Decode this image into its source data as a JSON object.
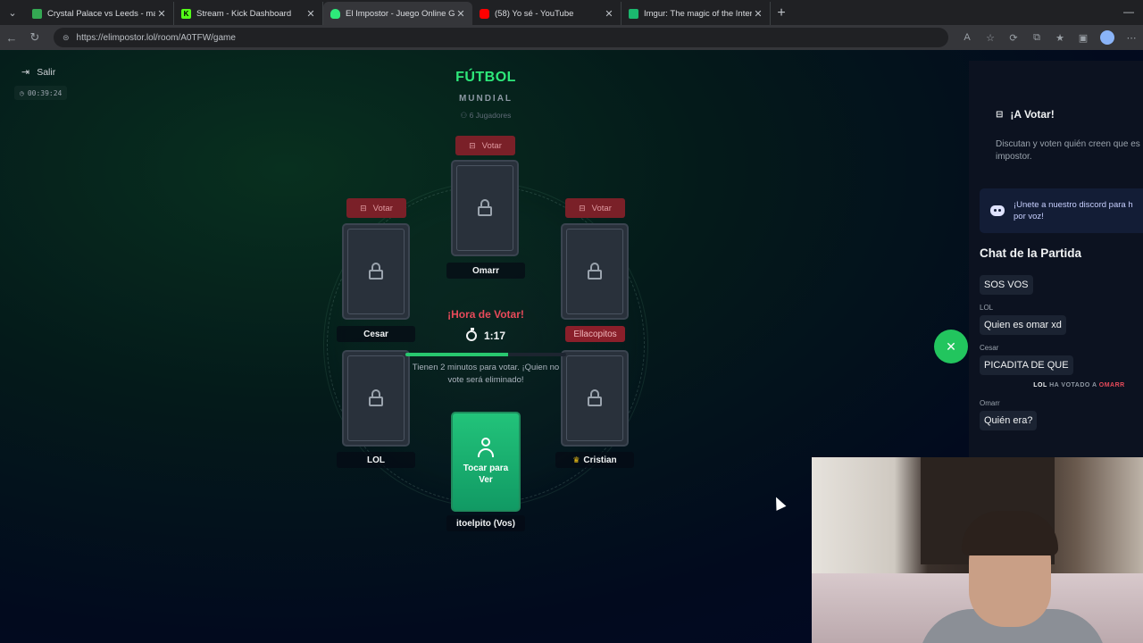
{
  "browser": {
    "tabs": [
      {
        "title": "Crystal Palace vs Leeds - marcador",
        "fav_color": "#34a853",
        "fav_glyph": "",
        "active": false
      },
      {
        "title": "Stream - Kick Dashboard",
        "fav_color": "#53fc18",
        "fav_glyph": "K",
        "active": false
      },
      {
        "title": "El Impostor - Juego Online Gratis",
        "fav_color": "#2ee87a",
        "fav_glyph": "",
        "active": true
      },
      {
        "title": "(58) Yo sé - YouTube",
        "fav_color": "#ff0000",
        "fav_glyph": "",
        "active": false
      },
      {
        "title": "Imgur: The magic of the Internet",
        "fav_color": "#1bb76e",
        "fav_glyph": "",
        "active": false
      }
    ],
    "url": "https://elimpostor.lol/room/A0TFW/game"
  },
  "game": {
    "exit_label": "Salir",
    "elapsed": "00:39:24",
    "category": "FÚTBOL",
    "mode": "MUNDIAL",
    "players_count": "6 Jugadores",
    "vote_label": "Votar",
    "players": {
      "top": "Omarr",
      "left_upper": "Cesar",
      "right_upper": "Ellacopitos",
      "left_lower": "LOL",
      "right_lower": "Cristian",
      "right_lower_icon": "crown-icon",
      "self": "itoelpito (Vos)"
    },
    "self_card_label": "Tocar para Ver",
    "vote_title": "¡Hora de Votar!",
    "countdown": "1:17",
    "time_progress": 0.64,
    "vote_message": "Tienen 2 minutos para votar. ¡Quien no vote será eliminado!",
    "accent": "#2ee87a",
    "danger": "#e84a5a"
  },
  "sidebar": {
    "vote_title": "¡A Votar!",
    "vote_desc_line1": "Discutan y voten quién creen que es",
    "vote_desc_line2": "impostor.",
    "discord_line1": "¡Unete a nuestro discord para h",
    "discord_line2": "por voz!",
    "chat_title": "Chat de la Partida",
    "messages": [
      {
        "author": "",
        "text": "SOS VOS"
      },
      {
        "author": "LOL",
        "text": "Quien es omar xd"
      },
      {
        "author": "Cesar",
        "text": "PICADITA DE QUE"
      }
    ],
    "system_event": {
      "voter": "LOL",
      "verb": "HA VOTADO A",
      "target": "OMARR"
    },
    "messages_after": [
      {
        "author": "Omarr",
        "text": "Quién era?"
      }
    ]
  }
}
